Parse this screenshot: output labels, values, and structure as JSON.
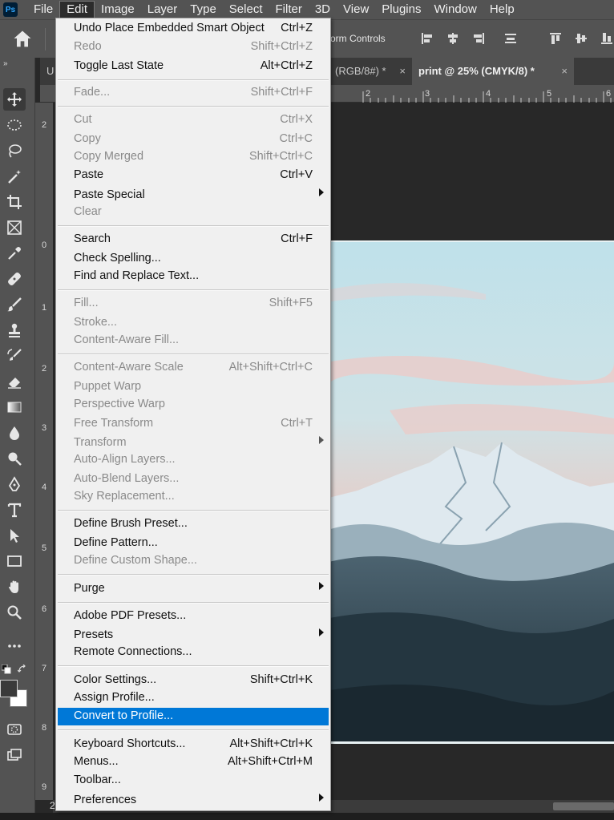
{
  "menubar": {
    "logo": "Ps",
    "items": [
      "File",
      "Edit",
      "Image",
      "Layer",
      "Type",
      "Select",
      "Filter",
      "3D",
      "View",
      "Plugins",
      "Window",
      "Help"
    ]
  },
  "options_bar": {
    "transform_controls_label": "orm Controls"
  },
  "tabs": [
    {
      "label": "U"
    },
    {
      "label": "(RGB/8#) *"
    },
    {
      "label": "print @ 25% (CMYK/8) *"
    }
  ],
  "tab_close_glyph": "×",
  "hruler_labels": [
    "2",
    "3",
    "4",
    "5",
    "6"
  ],
  "vruler_labels": [
    "2",
    "0",
    "1",
    "2",
    "3",
    "4",
    "5",
    "6",
    "7",
    "8",
    "9"
  ],
  "zoom_label": "2",
  "edit_menu": {
    "items": [
      {
        "label": "Undo Place Embedded Smart Object",
        "shortcut": "Ctrl+Z"
      },
      {
        "label": "Redo",
        "shortcut": "Shift+Ctrl+Z"
      },
      {
        "label": "Toggle Last State",
        "shortcut": "Alt+Ctrl+Z"
      },
      {
        "label": "Fade...",
        "shortcut": "Shift+Ctrl+F"
      },
      {
        "label": "Cut",
        "shortcut": "Ctrl+X"
      },
      {
        "label": "Copy",
        "shortcut": "Ctrl+C"
      },
      {
        "label": "Copy Merged",
        "shortcut": "Shift+Ctrl+C"
      },
      {
        "label": "Paste",
        "shortcut": "Ctrl+V"
      },
      {
        "label": "Paste Special",
        "shortcut": ""
      },
      {
        "label": "Clear",
        "shortcut": ""
      },
      {
        "label": "Search",
        "shortcut": "Ctrl+F"
      },
      {
        "label": "Check Spelling...",
        "shortcut": ""
      },
      {
        "label": "Find and Replace Text...",
        "shortcut": ""
      },
      {
        "label": "Fill...",
        "shortcut": "Shift+F5"
      },
      {
        "label": "Stroke...",
        "shortcut": ""
      },
      {
        "label": "Content-Aware Fill...",
        "shortcut": ""
      },
      {
        "label": "Content-Aware Scale",
        "shortcut": "Alt+Shift+Ctrl+C"
      },
      {
        "label": "Puppet Warp",
        "shortcut": ""
      },
      {
        "label": "Perspective Warp",
        "shortcut": ""
      },
      {
        "label": "Free Transform",
        "shortcut": "Ctrl+T"
      },
      {
        "label": "Transform",
        "shortcut": ""
      },
      {
        "label": "Auto-Align Layers...",
        "shortcut": ""
      },
      {
        "label": "Auto-Blend Layers...",
        "shortcut": ""
      },
      {
        "label": "Sky Replacement...",
        "shortcut": ""
      },
      {
        "label": "Define Brush Preset...",
        "shortcut": ""
      },
      {
        "label": "Define Pattern...",
        "shortcut": ""
      },
      {
        "label": "Define Custom Shape...",
        "shortcut": ""
      },
      {
        "label": "Purge",
        "shortcut": ""
      },
      {
        "label": "Adobe PDF Presets...",
        "shortcut": ""
      },
      {
        "label": "Presets",
        "shortcut": ""
      },
      {
        "label": "Remote Connections...",
        "shortcut": ""
      },
      {
        "label": "Color Settings...",
        "shortcut": "Shift+Ctrl+K"
      },
      {
        "label": "Assign Profile...",
        "shortcut": ""
      },
      {
        "label": "Convert to Profile...",
        "shortcut": ""
      },
      {
        "label": "Keyboard Shortcuts...",
        "shortcut": "Alt+Shift+Ctrl+K"
      },
      {
        "label": "Menus...",
        "shortcut": "Alt+Shift+Ctrl+M"
      },
      {
        "label": "Toolbar...",
        "shortcut": ""
      },
      {
        "label": "Preferences",
        "shortcut": ""
      }
    ]
  },
  "colors": {
    "menu_highlight": "#0078d7",
    "chrome": "#535353",
    "canvas_bg": "#282828"
  }
}
